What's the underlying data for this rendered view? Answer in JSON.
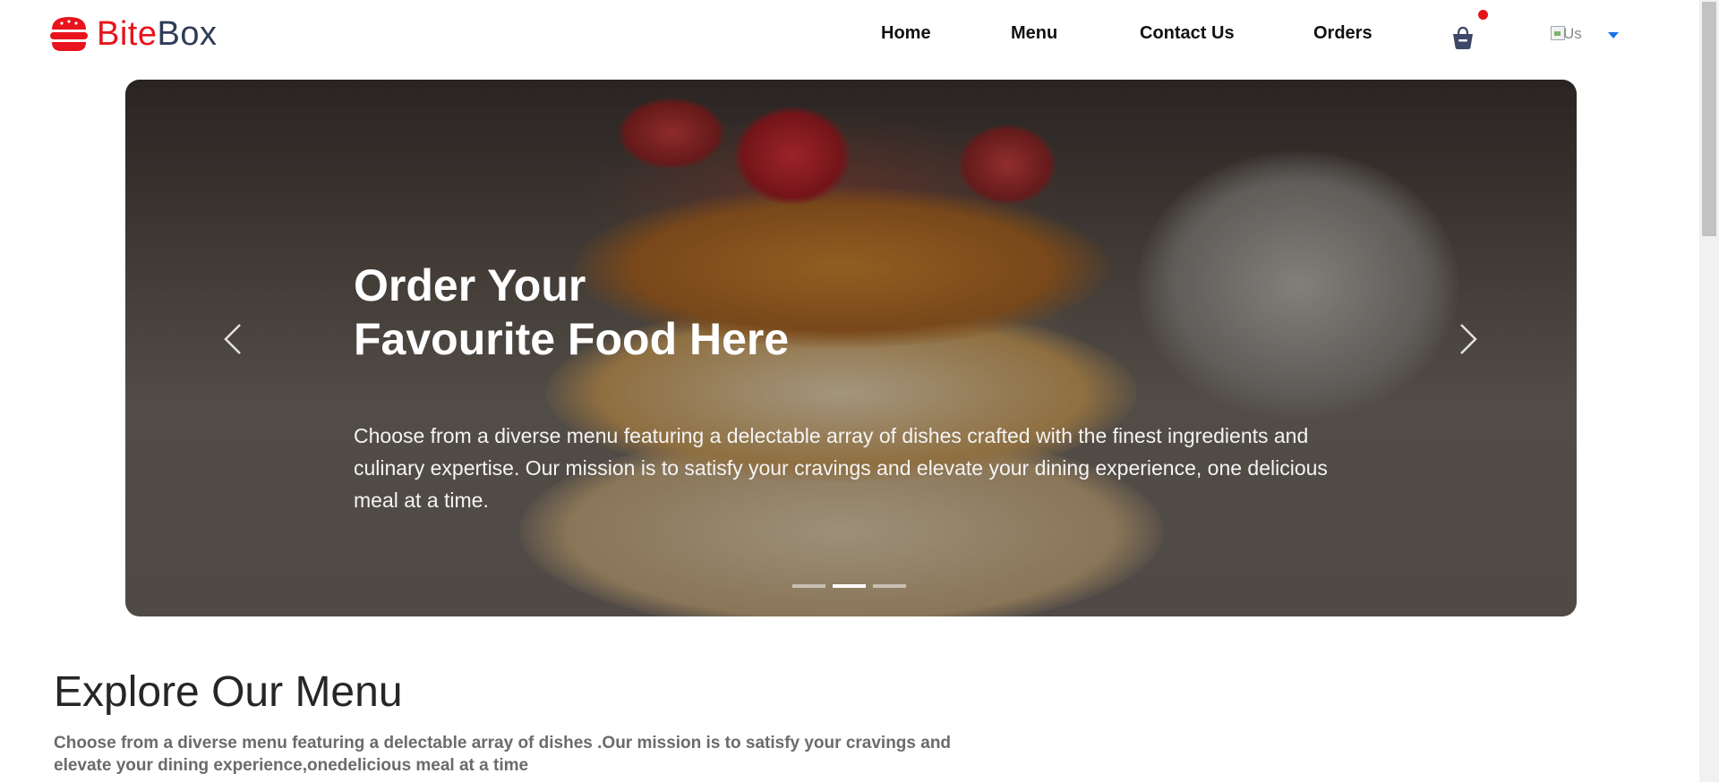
{
  "brand": {
    "name_part1": "Bite",
    "name_part2": "Box",
    "colors": {
      "red": "#e8131c",
      "navy": "#2f3c57"
    }
  },
  "nav": [
    {
      "label": "Home"
    },
    {
      "label": "Menu"
    },
    {
      "label": "Contact Us"
    },
    {
      "label": "Orders"
    }
  ],
  "cart": {
    "icon": "basket-icon",
    "has_notification": true
  },
  "language": {
    "flag_alt": "Us",
    "icon": "caret-down-icon"
  },
  "hero": {
    "title_line1": "Order Your",
    "title_line2": "Favourite Food Here",
    "description": "Choose from a diverse menu featuring a delectable array of dishes crafted with the finest ingredients and culinary expertise. Our mission is to satisfy your cravings and elevate your dining experience, one delicious meal at a time.",
    "slides": 3,
    "active_slide": 2
  },
  "explore": {
    "title": "Explore Our Menu",
    "description": "Choose from a diverse menu featuring a delectable array of dishes .Our mission is to satisfy your cravings and elevate your dining experience,onedelicious meal at a time"
  }
}
